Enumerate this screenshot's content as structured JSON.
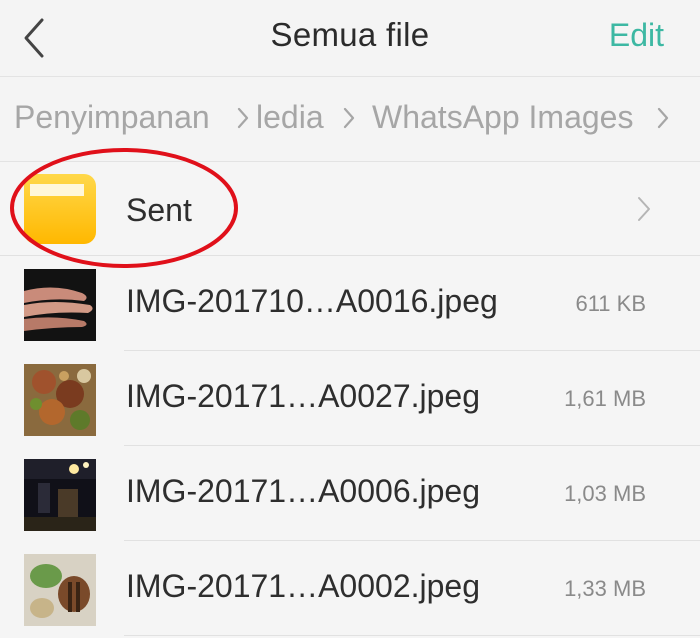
{
  "header": {
    "title": "Semua file",
    "edit_label": "Edit",
    "back_icon": "chevron-left-icon",
    "accent_color": "#3db8a3"
  },
  "breadcrumb": {
    "items": [
      "Penyimpanan",
      "ledia",
      "WhatsApp Images"
    ]
  },
  "folder": {
    "name": "Sent",
    "icon": "folder-icon",
    "icon_color": "#ffc21a"
  },
  "files": [
    {
      "name": "IMG-201710…A0016.jpeg",
      "size": "611 KB"
    },
    {
      "name": "IMG-20171…A0027.jpeg",
      "size": "1,61 MB"
    },
    {
      "name": "IMG-20171…A0006.jpeg",
      "size": "1,03 MB"
    },
    {
      "name": "IMG-20171…A0002.jpeg",
      "size": "1,33 MB"
    }
  ],
  "annotation_color": "#e0101a"
}
